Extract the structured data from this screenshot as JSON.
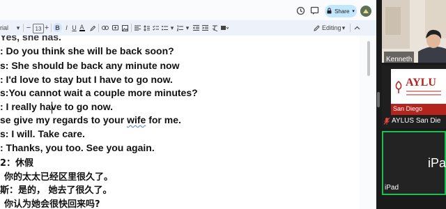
{
  "toolbar": {
    "font_name": "rial",
    "font_size": "13",
    "minus": "−",
    "plus": "+",
    "bold": "B",
    "italic": "I",
    "underline": "U",
    "text_color": "A",
    "editing_label": "Editing",
    "share_label": "Share"
  },
  "document": {
    "lines": [
      "Yes, she has.",
      ":  Do you think she will be back soon?",
      "s: She should be back any minute now",
      ":  I'd love to stay but I have to go now.",
      "s:You cannot wait a couple more minutes?",
      ": I really have to go now.",
      "se give my regards to your ",
      "s: I will. Take care.",
      ": Thanks, you too. See you again.",
      "2：休假",
      "你的太太已经区里很久了。",
      "斯：是的， 她去了很久了。",
      "你认为她会很快回来吗?"
    ],
    "underlined_phrase": "wife",
    "line7_end": " for me."
  },
  "zoom": {
    "tile1_name": "Kenneth",
    "logo_title": "AYLU",
    "logo_sub": "San Diego",
    "tile2_name": "AYLUS San Die",
    "tile3_center": "iPa",
    "tile3_name": "iPad"
  },
  "colors": {
    "share_bg": "#c2e7ff",
    "toolbar_bg": "#edf2fa",
    "active_speaker_border": "#19c24f",
    "logo_red": "#b5231f"
  }
}
